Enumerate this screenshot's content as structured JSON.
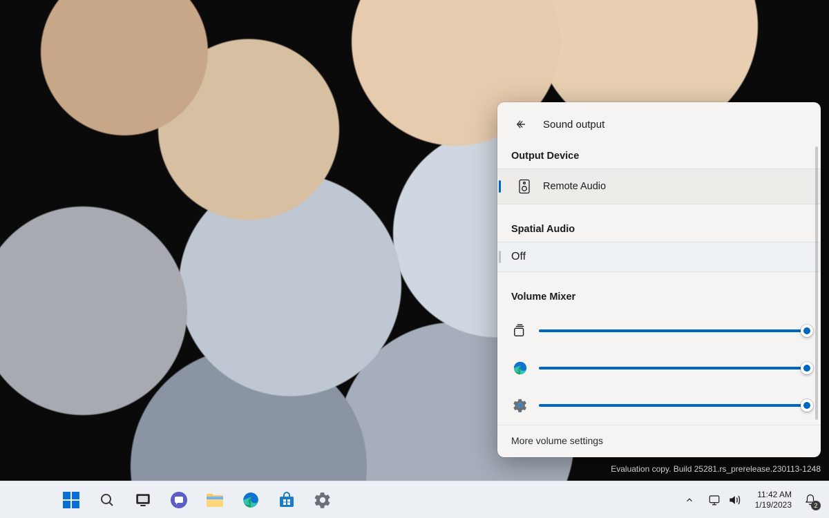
{
  "flyout": {
    "title": "Sound output",
    "output_device_label": "Output Device",
    "output_device_value": "Remote Audio",
    "spatial_audio_label": "Spatial Audio",
    "spatial_audio_value": "Off",
    "volume_mixer_label": "Volume Mixer",
    "more_settings": "More volume settings",
    "mixer": [
      {
        "icon": "cast-icon",
        "value": 100
      },
      {
        "icon": "edge-icon",
        "value": 100
      },
      {
        "icon": "gear-icon",
        "value": 100
      }
    ]
  },
  "watermark": {
    "line1": "Evaluation copy. Build 25281.rs_prerelease.230113-1248"
  },
  "taskbar": {
    "apps": [
      "start-icon",
      "search-icon",
      "taskview-icon",
      "chat-icon",
      "explorer-icon",
      "edge-icon",
      "store-icon",
      "settings-icon"
    ]
  },
  "tray": {
    "time": "11:42 AM",
    "date": "1/19/2023",
    "notif_count": "2"
  },
  "colors": {
    "accent": "#0067c0"
  }
}
